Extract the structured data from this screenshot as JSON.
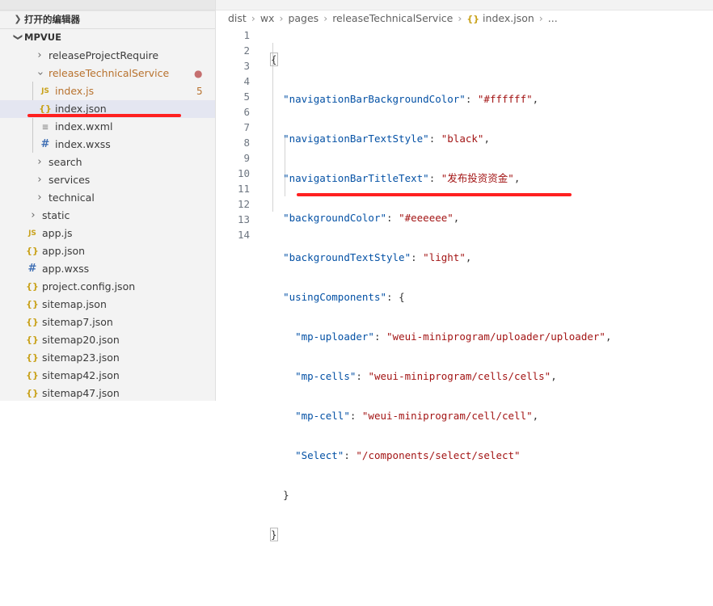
{
  "sidebar": {
    "open_editors_label": "打开的编辑器",
    "project_label": "MPVUE",
    "items": [
      {
        "label": "releaseProjectRequire",
        "type": "folder",
        "expanded": false
      },
      {
        "label": "releaseTechnicalService",
        "type": "folder",
        "expanded": true,
        "status": "●"
      },
      {
        "label": "index.js",
        "type": "js",
        "icon": "JS",
        "badge": "5"
      },
      {
        "label": "index.json",
        "type": "json",
        "icon": "{}"
      },
      {
        "label": "index.wxml",
        "type": "wxml",
        "icon": "≡"
      },
      {
        "label": "index.wxss",
        "type": "wxss",
        "icon": "#"
      },
      {
        "label": "search",
        "type": "folder",
        "expanded": false
      },
      {
        "label": "services",
        "type": "folder",
        "expanded": false
      },
      {
        "label": "technical",
        "type": "folder",
        "expanded": false
      },
      {
        "label": "static",
        "type": "folder",
        "expanded": false
      },
      {
        "label": "app.js",
        "type": "js",
        "icon": "JS"
      },
      {
        "label": "app.json",
        "type": "json",
        "icon": "{}"
      },
      {
        "label": "app.wxss",
        "type": "wxss",
        "icon": "#"
      },
      {
        "label": "project.config.json",
        "type": "json",
        "icon": "{}"
      },
      {
        "label": "sitemap.json",
        "type": "json",
        "icon": "{}"
      },
      {
        "label": "sitemap7.json",
        "type": "json",
        "icon": "{}"
      },
      {
        "label": "sitemap20.json",
        "type": "json",
        "icon": "{}"
      },
      {
        "label": "sitemap23.json",
        "type": "json",
        "icon": "{}"
      },
      {
        "label": "sitemap42.json",
        "type": "json",
        "icon": "{}"
      },
      {
        "label": "sitemap47.json",
        "type": "json",
        "icon": "{}"
      }
    ]
  },
  "breadcrumb": {
    "parts": [
      "dist",
      "wx",
      "pages",
      "releaseTechnicalService"
    ],
    "file_icon": "{}",
    "file": "index.json",
    "more": "..."
  },
  "editor": {
    "line_numbers": [
      "1",
      "2",
      "3",
      "4",
      "5",
      "6",
      "7",
      "8",
      "9",
      "10",
      "11",
      "12",
      "13",
      "14"
    ],
    "code": {
      "l1": {
        "open": "{"
      },
      "l2": {
        "key": "\"navigationBarBackgroundColor\"",
        "colon": ": ",
        "value": "\"#ffffff\"",
        "comma": ","
      },
      "l3": {
        "key": "\"navigationBarTextStyle\"",
        "colon": ": ",
        "value": "\"black\"",
        "comma": ","
      },
      "l4": {
        "key": "\"navigationBarTitleText\"",
        "colon": ": ",
        "value": "\"发布投资资金\"",
        "comma": ","
      },
      "l5": {
        "key": "\"backgroundColor\"",
        "colon": ": ",
        "value": "\"#eeeeee\"",
        "comma": ","
      },
      "l6": {
        "key": "\"backgroundTextStyle\"",
        "colon": ": ",
        "value": "\"light\"",
        "comma": ","
      },
      "l7": {
        "key": "\"usingComponents\"",
        "colon": ": ",
        "value": "{"
      },
      "l8": {
        "key": "\"mp-uploader\"",
        "colon": ": ",
        "value": "\"weui-miniprogram/uploader/uploader\"",
        "comma": ","
      },
      "l9": {
        "key": "\"mp-cells\"",
        "colon": ": ",
        "value": "\"weui-miniprogram/cells/cells\"",
        "comma": ","
      },
      "l10": {
        "key": "\"mp-cell\"",
        "colon": ": ",
        "value": "\"weui-miniprogram/cell/cell\"",
        "comma": ","
      },
      "l11": {
        "key": "\"Select\"",
        "colon": ": ",
        "value": "\"/components/select/select\""
      },
      "l12": {
        "close": "}"
      },
      "l13": {
        "close": "}"
      }
    }
  },
  "colors": {
    "annotation_red": "#ff2020",
    "json_key": "#0451a5",
    "json_string": "#a31515",
    "selected_row": "#e4e6f1"
  }
}
